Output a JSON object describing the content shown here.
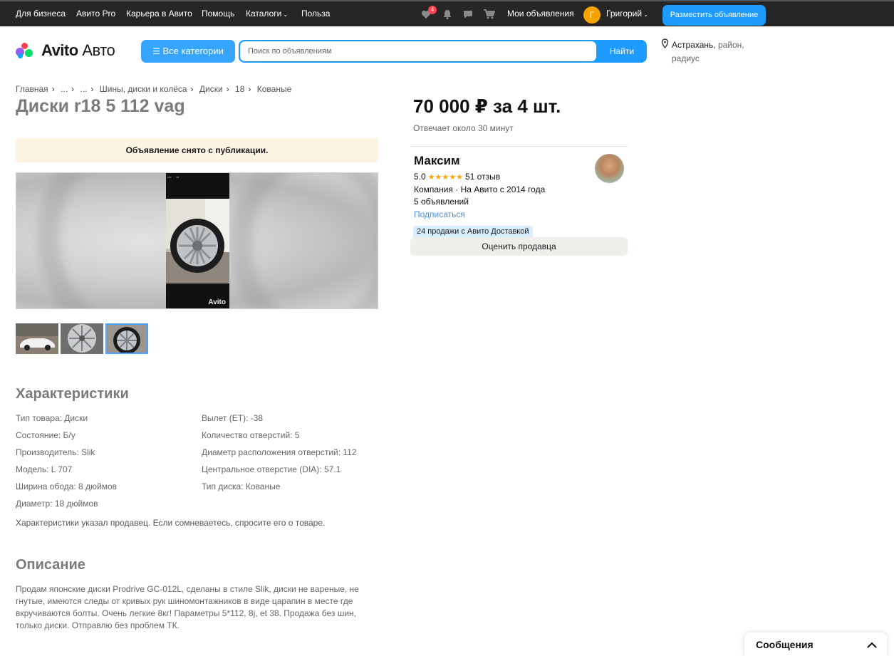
{
  "topbar": {
    "links": [
      "Для бизнеса",
      "Авито Pro",
      "Карьера в Авито",
      "Помощь",
      "Каталоги",
      "Польза"
    ],
    "favorites_badge": "4",
    "my_ads": "Мои объявления",
    "user_initial": "Г",
    "user_name": "Григорий",
    "post_button": "Разместить объявление"
  },
  "header": {
    "logo_bold": "Avito",
    "logo_light": "Авто",
    "categories_button": "Все категории",
    "search_placeholder": "Поиск по объявлениям",
    "search_button": "Найти",
    "location_city": "Астрахань,",
    "location_rest": "район,",
    "location_line2": "радиус"
  },
  "breadcrumbs": [
    "Главная",
    "...",
    "...",
    "Шины, диски и колёса",
    "Диски",
    "18",
    "Кованые"
  ],
  "listing": {
    "title": "Диски r18 5 112 vag",
    "notice": "Объявление снято с публикации.",
    "watermark": "Avito"
  },
  "characteristics": {
    "heading": "Характеристики",
    "left": [
      "Тип товара: Диски",
      "Состояние: Б/у",
      "Производитель: Slik",
      "Модель: L 707",
      "Ширина обода: 8 дюймов",
      "Диаметр: 18 дюймов"
    ],
    "right": [
      "Вылет (ET): -38",
      "Количество отверстий: 5",
      "Диаметр расположения отверстий: 112",
      "Центральное отверстие (DIA): 57.1",
      "Тип диска: Кованые"
    ],
    "note": "Характеристики указал продавец. Если сомневаетесь, спросите его о товаре."
  },
  "description": {
    "heading": "Описание",
    "text": "Продам японские диски Prodrive GC-012L, сделаны в стиле Slik, диски не вареные, не гнутые, имеются следы от кривых рук шиномонтажников в виде царапин в месте где вкручиваются болты. Очень легкие 8кг! Параметры 5*112, 8j, et 38. Продажа без шин, только диски. Отправлю без проблем ТК."
  },
  "offer": {
    "price": "70 000 ₽ за 4 шт.",
    "reply_time": "Отвечает около 30 минут"
  },
  "seller": {
    "name": "Максим",
    "rating": "5.0",
    "stars": "★★★★★",
    "reviews": "51 отзыв",
    "company_line": "Компания · На Авито с 2014 года",
    "ads_count": "5 объявлений",
    "subscribe": "Подписаться",
    "delivery_badge": "24 продажи с Авито Доставкой",
    "rate_button": "Оценить продавца"
  },
  "messages": {
    "label": "Сообщения"
  }
}
